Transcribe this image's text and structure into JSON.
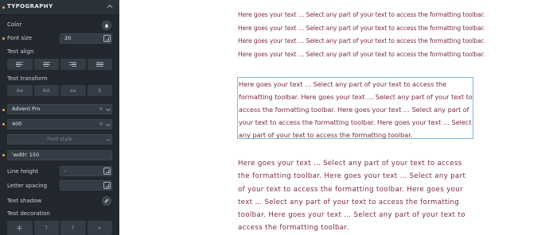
{
  "sidebar": {
    "section_title": "TYPOGRAPHY",
    "color_label": "Color",
    "font_size_label": "Font size",
    "font_size_value": "20",
    "text_align_label": "Text align",
    "text_transform_label": "Text transform",
    "transform_options": [
      "Aa",
      "AA",
      "aa",
      "X"
    ],
    "font_family_value": "Advent Pro",
    "font_weight_value": "400",
    "font_style_placeholder": "Font style",
    "variation_value": "'wdth' 150",
    "line_height_label": "Line height",
    "line_height_value": "-",
    "letter_spacing_label": "Letter spacing",
    "text_shadow_label": "Text shadow",
    "text_decoration_label": "Text decoration",
    "clear_symbol": "×",
    "decoration_symbols": [
      "T",
      "T",
      "×"
    ]
  },
  "canvas": {
    "text_color": "#7a2b41",
    "selection_border_color": "#7db7e2",
    "block1_lines": [
      "Here goes your text … Select any part of your text to access the formatting toolbar.",
      "Here goes your text … Select any part of your text to access the formatting toolbar.",
      "Here goes your text … Select any part of your text to access the formatting toolbar.",
      "Here goes your text … Select any part of your text to access the formatting toolbar."
    ],
    "block2_lines": [
      "Here goes your text … Select any part of your text to access the",
      "formatting toolbar. Here goes your text … Select any part of your text to",
      "access the formatting toolbar. Here goes your text … Select any part of",
      "your text to access the formatting toolbar. Here goes your text … Select",
      "any part of your text to access the formatting toolbar."
    ],
    "block3_lines": [
      "Here goes your text … Select any part of your text to access",
      "the formatting toolbar. Here goes your text … Select any part",
      "of your text to access the formatting toolbar. Here goes your",
      "text … Select any part of your text to access the formatting",
      "toolbar. Here goes your text … Select any part of your text to",
      "access the formatting toolbar."
    ]
  }
}
